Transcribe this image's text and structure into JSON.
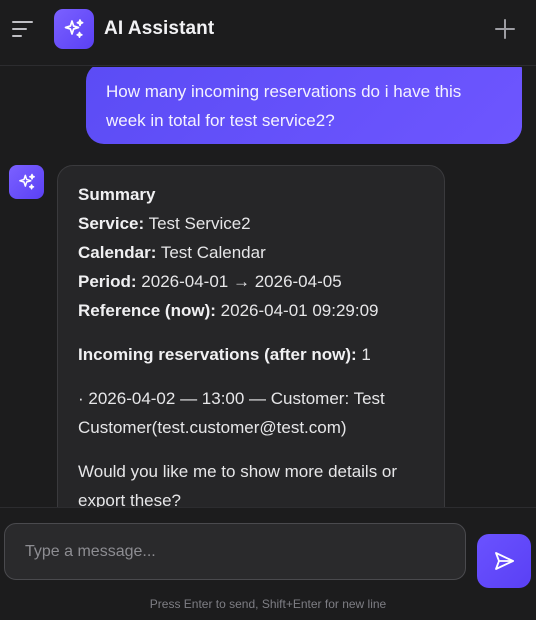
{
  "header": {
    "title": "AI Assistant",
    "menu_icon": "menu-icon",
    "logo_icon": "sparkles-icon",
    "new_chat_icon": "plus-icon"
  },
  "conversation": {
    "user_message": "How many incoming reservations do i have this week in total for test service2?",
    "assistant": {
      "heading": "Summary",
      "service_label": "Service:",
      "service_value": "Test Service2",
      "calendar_label": "Calendar:",
      "calendar_value": "Test Calendar",
      "period_label": "Period:",
      "period_value": "2026-04-01 → 2026-04-05",
      "reference_label": "Reference (now):",
      "reference_value": "2026-04-01 09:29:09",
      "incoming_label": "Incoming reservations (after now):",
      "incoming_value": "1",
      "reservation_line": "· 2026-04-02 — 13:00 — Customer: Test Customer(test.customer@test.com)",
      "followup": "Would you like me to show more details or export these?"
    }
  },
  "composer": {
    "placeholder": "Type a message...",
    "hint": "Press Enter to send, Shift+Enter for new line",
    "send_icon": "send-icon"
  },
  "colors": {
    "accent": "#5b4cf5",
    "background": "#1c1c1d",
    "bubble": "#262628"
  }
}
